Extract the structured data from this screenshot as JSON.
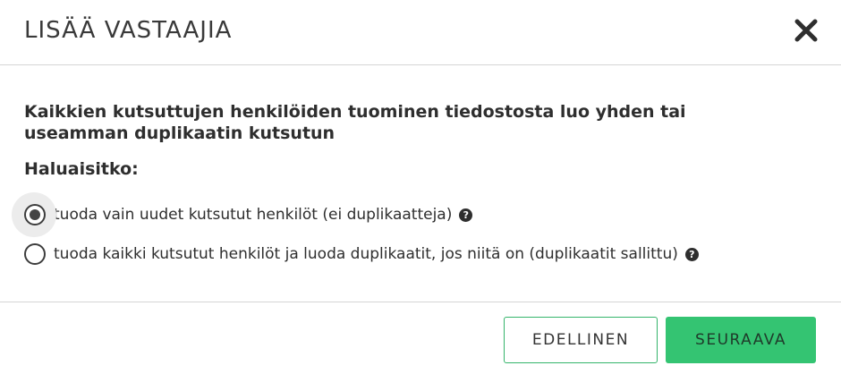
{
  "dialog": {
    "title": "LISÄÄ VASTAAJIA"
  },
  "message": {
    "description": "Kaikkien kutsuttujen henkilöiden tuominen tiedostosta luo yhden tai useamman duplikaatin kutsutun",
    "question": "Haluaisitko:"
  },
  "options": [
    {
      "label": "tuoda vain uudet kutsutut henkilöt (ei duplikaatteja)",
      "selected": true
    },
    {
      "label": "tuoda kaikki kutsutut henkilöt ja luoda duplikaatit, jos niitä on (duplikaatit sallittu)",
      "selected": false
    }
  ],
  "icons": {
    "close": "close-icon",
    "help": "help-icon"
  },
  "footer": {
    "prev_label": "EDELLINEN",
    "next_label": "SEURAAVA"
  },
  "colors": {
    "accent": "#34c472",
    "accent_border": "#35b46b"
  }
}
